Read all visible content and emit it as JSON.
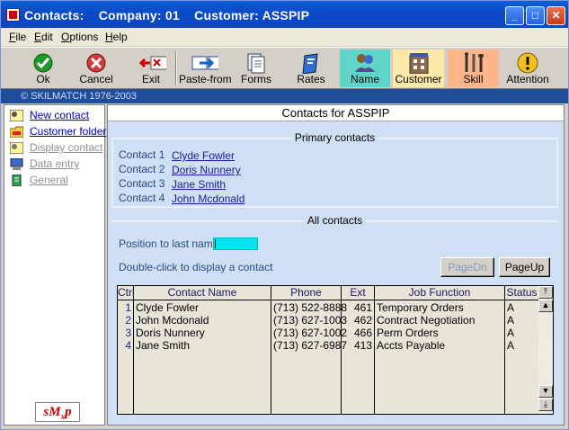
{
  "window": {
    "title": "Contacts:    Company: 01    Customer: ASSPIP",
    "controls": [
      "minimize",
      "maximize",
      "close"
    ]
  },
  "menu": [
    {
      "label": "File",
      "accel": "F"
    },
    {
      "label": "Edit",
      "accel": "E"
    },
    {
      "label": "Options",
      "accel": "O"
    },
    {
      "label": "Help",
      "accel": "H"
    }
  ],
  "toolbar": {
    "ok": "Ok",
    "cancel": "Cancel",
    "exit": "Exit",
    "paste_from": "Paste-from",
    "forms": "Forms",
    "rates": "Rates",
    "name": "Name",
    "customer": "Customer",
    "skill": "Skill",
    "attention": "Attention"
  },
  "status_line": "© SKILMATCH 1976-2003",
  "sidebar": {
    "items": [
      {
        "label": "New contact",
        "icon": "new-contact-icon",
        "state": "active"
      },
      {
        "label": "Customer folder",
        "icon": "folder-icon",
        "state": "active"
      },
      {
        "label": "Display contact",
        "icon": "contact-icon",
        "state": "disabled"
      },
      {
        "label": "Data entry",
        "icon": "monitor-icon",
        "state": "disabled"
      },
      {
        "label": "General",
        "icon": "general-icon",
        "state": "disabled"
      }
    ],
    "logo": "sM xp"
  },
  "main": {
    "title": "Contacts for ASSPIP",
    "primary": {
      "heading": "Primary contacts",
      "contacts": [
        {
          "label": "Contact 1",
          "name": "Clyde Fowler"
        },
        {
          "label": "Contact 2",
          "name": "Doris Nunnery"
        },
        {
          "label": "Contact 3",
          "name": "Jane Smith"
        },
        {
          "label": "Contact 4",
          "name": "John Mcdonald"
        }
      ]
    },
    "all": {
      "heading": "All contacts",
      "position_label": "Position to last name",
      "position_value": "",
      "hint": "Double-click to display a contact",
      "page_down": "PageDn",
      "page_up": "PageUp",
      "columns": [
        "Ctrl",
        "Contact Name",
        "Phone",
        "Ext",
        "Job Function",
        "Status"
      ],
      "rows": [
        {
          "ctrl": "1",
          "name": "Clyde Fowler",
          "phone": "(713) 522-8888",
          "ext": "461",
          "job": "Temporary Orders",
          "status": "A"
        },
        {
          "ctrl": "2",
          "name": "John Mcdonald",
          "phone": "(713) 627-1003",
          "ext": "462",
          "job": "Contract Negotiation",
          "status": "A"
        },
        {
          "ctrl": "3",
          "name": "Doris Nunnery",
          "phone": "(713) 627-1002",
          "ext": "466",
          "job": "Perm Orders",
          "status": "A"
        },
        {
          "ctrl": "4",
          "name": "Jane Smith",
          "phone": "(713) 627-6987",
          "ext": "413",
          "job": "Accts Payable",
          "status": "A"
        }
      ]
    }
  },
  "colors": {
    "titlebar": "#0b4bc7",
    "name_highlight": "#5dd6c9",
    "customer_highlight": "#ffe9a8",
    "skill_highlight": "#ffb68a",
    "panel_bg": "#cfe0f4",
    "input_bg": "#00e5f0"
  }
}
